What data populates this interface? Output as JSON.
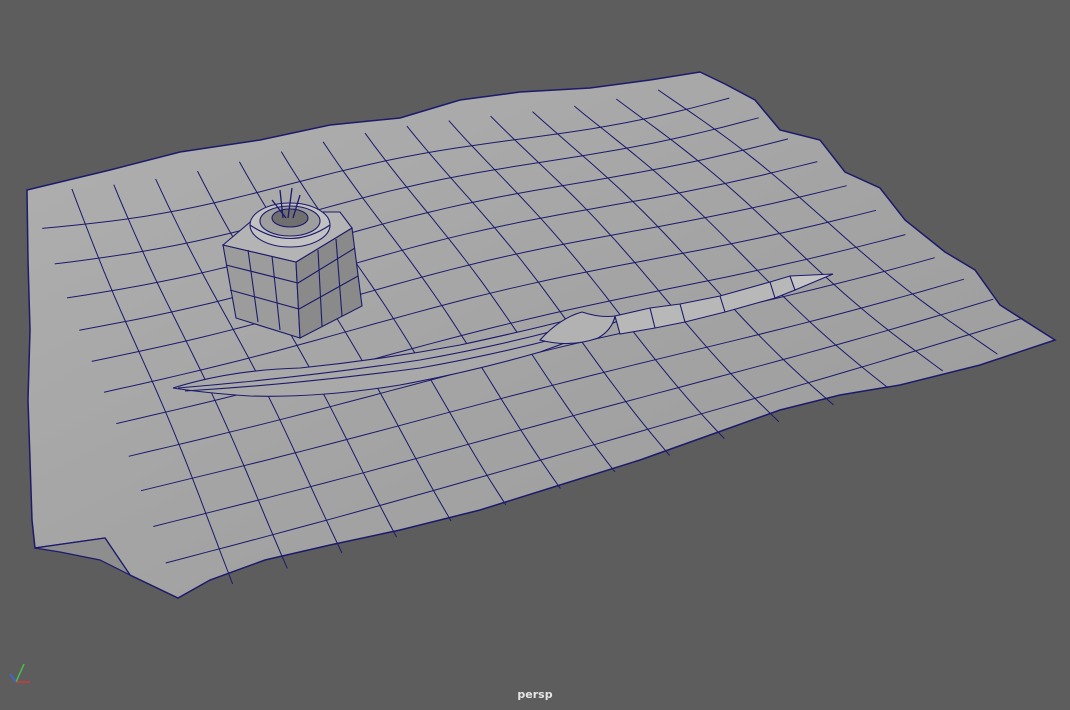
{
  "viewport": {
    "camera_label": "persp",
    "background_color": "#5d5d5d",
    "wireframe_color": "#1c1a6b",
    "surface_color": "#a3a3a3"
  },
  "scene_objects": [
    "paper-sheet",
    "ink-bottle",
    "quill-pen"
  ],
  "axis_gizmo": {
    "icon": "axis-gizmo-icon",
    "x_color": "#d23a3a",
    "y_color": "#4cc04c",
    "z_color": "#3a6bd6"
  }
}
